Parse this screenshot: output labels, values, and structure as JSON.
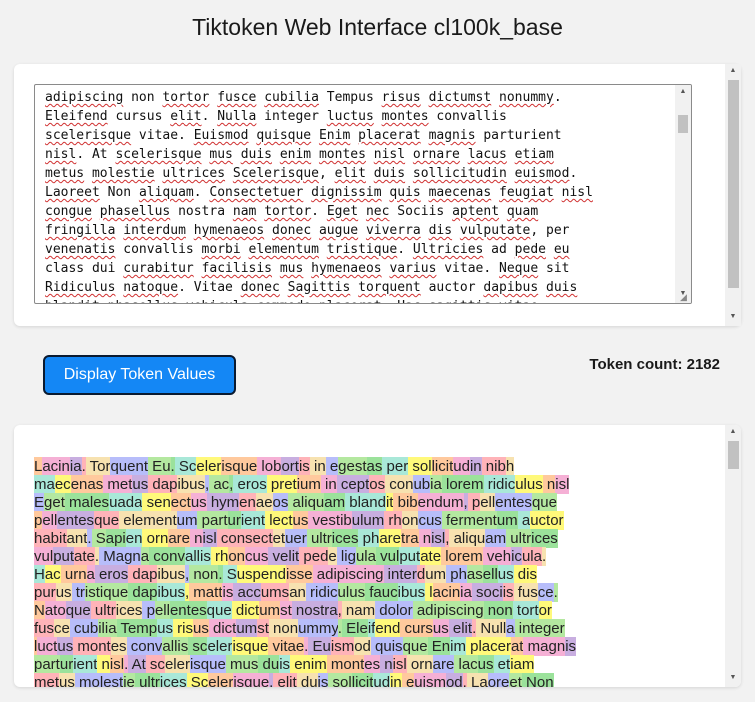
{
  "title": "Tiktoken Web Interface cl100k_base",
  "input": {
    "lines": [
      [
        [
          "adipiscing",
          1
        ],
        " non ",
        [
          "tortor",
          1
        ],
        " ",
        [
          "fusce",
          1
        ],
        " ",
        [
          "cubilia",
          1
        ],
        " Tempus ",
        [
          "risus",
          1
        ],
        " ",
        [
          "dictumst",
          1
        ],
        " ",
        [
          "nonummy",
          1
        ],
        "."
      ],
      [
        [
          "Eleifend",
          1
        ],
        " cursus ",
        [
          "elit",
          1
        ],
        ". ",
        [
          "Nulla",
          1
        ],
        " integer ",
        [
          "luctus",
          1
        ],
        " ",
        [
          "montes",
          1
        ],
        " convallis"
      ],
      [
        [
          "scelerisque",
          1
        ],
        " vitae. ",
        [
          "Euismod",
          1
        ],
        " ",
        [
          "quisque",
          1
        ],
        " ",
        [
          "Enim",
          1
        ],
        " ",
        [
          "placerat",
          1
        ],
        " ",
        [
          "magnis",
          1
        ],
        " parturient"
      ],
      [
        [
          "nisl",
          1
        ],
        ". At ",
        [
          "scelerisque",
          1
        ],
        " ",
        [
          "mus",
          1
        ],
        " ",
        [
          "duis",
          1
        ],
        " ",
        [
          "enim",
          1
        ],
        " ",
        [
          "montes",
          1
        ],
        " ",
        [
          "nisl",
          1
        ],
        " ",
        [
          "ornare",
          1
        ],
        " ",
        [
          "lacus",
          1
        ],
        " ",
        [
          "etiam",
          1
        ]
      ],
      [
        [
          "metus",
          1
        ],
        " ",
        [
          "molestie",
          1
        ],
        " ",
        [
          "ultrices",
          1
        ],
        " ",
        [
          "Scelerisque",
          1
        ],
        ", ",
        [
          "elit",
          1
        ],
        " ",
        [
          "duis",
          1
        ],
        " ",
        [
          "sollicitudin",
          1
        ],
        " ",
        [
          "euismod",
          1
        ],
        "."
      ],
      [
        [
          "Laoreet",
          1
        ],
        " Non ",
        [
          "aliquam",
          1
        ],
        ". ",
        [
          "Consectetuer",
          1
        ],
        " ",
        [
          "dignissim",
          1
        ],
        " ",
        [
          "quis",
          1
        ],
        " ",
        [
          "maecenas",
          1
        ],
        " ",
        [
          "feugiat",
          1
        ],
        " ",
        [
          "nisl",
          1
        ]
      ],
      [
        [
          "congue",
          1
        ],
        " ",
        [
          "phasellus",
          1
        ],
        " nostra ",
        [
          "nam",
          1
        ],
        " ",
        [
          "tortor",
          1
        ],
        ". ",
        [
          "Eget",
          1
        ],
        " ",
        [
          "nec",
          1
        ],
        " Sociis ",
        [
          "aptent",
          1
        ],
        " ",
        [
          "quam",
          1
        ]
      ],
      [
        [
          "fringilla",
          1
        ],
        " ",
        [
          "interdum",
          1
        ],
        " ",
        [
          "hymenaeos",
          1
        ],
        " ",
        [
          "donec",
          1
        ],
        " ",
        [
          "augue",
          1
        ],
        " ",
        [
          "viverra",
          1
        ],
        " ",
        [
          "dis",
          1
        ],
        " ",
        [
          "vulputate",
          1
        ],
        ", per"
      ],
      [
        [
          "venenatis",
          1
        ],
        " convallis ",
        [
          "morbi",
          1
        ],
        " ",
        [
          "elementum",
          1
        ],
        " ",
        [
          "tristique",
          1
        ],
        ". ",
        [
          "Ultricies",
          1
        ],
        " ad ",
        [
          "pede",
          1
        ],
        " ",
        [
          "eu",
          1
        ]
      ],
      [
        "class dui ",
        [
          "curabitur",
          1
        ],
        " ",
        [
          "facilisis",
          1
        ],
        " ",
        [
          "mus",
          1
        ],
        " ",
        [
          "hymenaeos",
          1
        ],
        " ",
        [
          "varius",
          1
        ],
        " vitae. ",
        [
          "Neque",
          1
        ],
        " sit"
      ],
      [
        [
          "Ridiculus",
          1
        ],
        " ",
        [
          "natoque",
          1
        ],
        ". Vitae ",
        [
          "donec",
          1
        ],
        " ",
        [
          "Sagittis",
          1
        ],
        " ",
        [
          "torquent",
          1
        ],
        " auctor ",
        [
          "dapibus",
          1
        ],
        " ",
        [
          "duis",
          1
        ]
      ],
      [
        [
          "blandit",
          1
        ],
        " ",
        [
          "phasellus",
          1
        ],
        " ",
        [
          "vehicula",
          1
        ],
        " ",
        [
          "commodo",
          1
        ],
        " ",
        [
          "placerat",
          1
        ],
        ". Hac ",
        [
          "sagittis",
          1
        ],
        " vitae."
      ]
    ]
  },
  "button_label": "Display Token Values",
  "token_count_label": "Token count:",
  "token_count": "2182",
  "palette": [
    "#ffc99d",
    "#ffb3b8",
    "#b4e8a0",
    "#fff97a",
    "#c8aee0",
    "#b7bdfa",
    "#a9e8d8",
    "#f5b0d5",
    "#f7e2b0",
    "#9be29b"
  ],
  "token_lines": [
    [
      "L",
      "acin",
      "ia",
      ".",
      " Tor",
      "quent",
      " Eu",
      ".",
      " Sc",
      "eler",
      "isque",
      " lob",
      "ort",
      "is",
      " in",
      " e",
      "gest",
      "as",
      " per",
      " sol",
      "licit",
      "ud",
      "in",
      " nib",
      "h"
    ],
    [
      "ma",
      "ec",
      "enas",
      " met",
      "us",
      " dap",
      "ibus",
      ",",
      " ac",
      ",",
      " eros",
      " pret",
      "ium",
      " in",
      " cept",
      "os",
      " con",
      "ub",
      "ia",
      " lorem",
      " ridic",
      "ulus",
      " n",
      "isl"
    ],
    [
      "E",
      "get",
      " males",
      "uada",
      " sen",
      "ect",
      "us",
      " hym",
      "en",
      "ae",
      "os",
      " aliqu",
      "am",
      " bland",
      "it",
      " bib",
      "endum",
      ",",
      " p",
      "ell",
      "entes",
      "que"
    ],
    [
      "p",
      "ell",
      "entes",
      "que",
      " element",
      "um",
      " part",
      "ur",
      "ient",
      " lect",
      "us",
      " vestib",
      "ulum",
      " rh",
      "on",
      "cus",
      " ferment",
      "um",
      " a",
      "uctor"
    ],
    [
      "habit",
      "ant",
      ".",
      " S",
      "api",
      "en",
      " orn",
      "are",
      " n",
      "isl",
      " consect",
      "et",
      "uer",
      " ultr",
      "ices",
      " ph",
      "are",
      "tra",
      " n",
      "isl",
      ",",
      " aliqu",
      "am",
      " ultr",
      "ices"
    ],
    [
      "vul",
      "put",
      "ate",
      ".",
      " Magn",
      "a",
      " conv",
      "allis",
      " rh",
      "on",
      "cus",
      " velit",
      " ped",
      "e",
      " lig",
      "ula",
      " vul",
      "put",
      "ate",
      " lorem",
      " veh",
      "ic",
      "ula",
      "."
    ],
    [
      "H",
      "ac",
      " urn",
      "a",
      " eros",
      " dap",
      "ibus",
      ",",
      " non",
      ".",
      " S",
      "uspend",
      "isse",
      " adipiscing",
      " inter",
      "d",
      "um",
      " ph",
      "as",
      "ell",
      "us",
      " dis"
    ],
    [
      "pur",
      "us",
      " tr",
      "istique",
      " dap",
      "ibus",
      ",",
      " matt",
      "is",
      " acc",
      "ums",
      "an",
      " ridic",
      "ulus",
      " fauc",
      "ibus",
      " l",
      "acin",
      "ia",
      " soci",
      "is",
      " fus",
      "ce",
      "."
    ],
    [
      "N",
      "ato",
      "que",
      " ultr",
      "ices",
      " p",
      "ell",
      "entes",
      "que",
      " dict",
      "um",
      "st",
      " nostra",
      ",",
      " nam",
      " dolor",
      " adipiscing",
      " non",
      " tort",
      "or"
    ],
    [
      "fus",
      "ce",
      " cub",
      "ilia",
      " Temp",
      "us",
      " ris",
      "us",
      " dict",
      "um",
      "st",
      " non",
      "ummy",
      ".",
      " Ele",
      "if",
      "end",
      " curs",
      "us",
      " elit",
      ".",
      " Null",
      "a",
      " integer"
    ],
    [
      "l",
      "uct",
      "us",
      " mont",
      "es",
      " conv",
      "allis",
      " sc",
      "eler",
      "isque",
      " vitae",
      ".",
      " Eu",
      "ism",
      "od",
      " quis",
      "que",
      " En",
      "im",
      " placer",
      "at",
      " magn",
      "is"
    ],
    [
      "part",
      "ur",
      "ient",
      " n",
      "isl",
      ".",
      " At",
      " sc",
      "eler",
      "isque",
      " mus",
      " du",
      "is",
      " enim",
      " mont",
      "es",
      " n",
      "isl",
      " orn",
      "are",
      " lac",
      "us",
      " et",
      "iam"
    ],
    [
      "met",
      "us",
      " molest",
      "ie",
      " ultr",
      "ices",
      " Sc",
      "eler",
      "isque",
      ",",
      " elit",
      " du",
      "is",
      " sol",
      "licit",
      "ud",
      "in",
      " e",
      "uism",
      "od",
      ".",
      " La",
      "ore",
      "et",
      " Non"
    ]
  ]
}
